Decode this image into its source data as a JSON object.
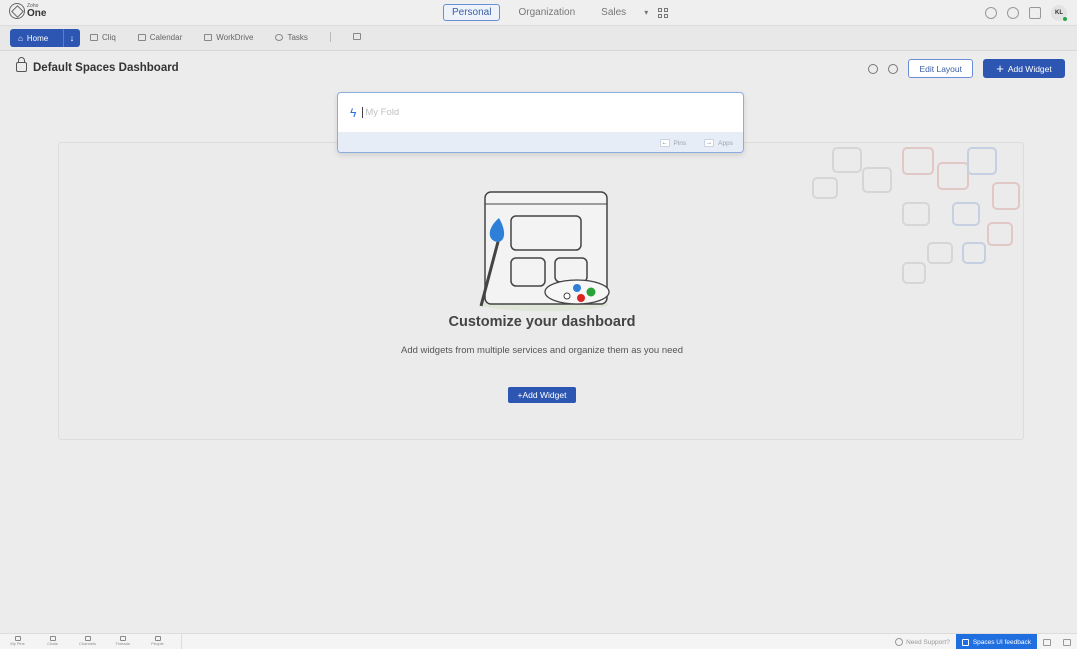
{
  "app": {
    "logo_small": "Zoho",
    "logo_big": "One"
  },
  "scope_tabs": [
    "Personal",
    "Organization",
    "Sales"
  ],
  "user": {
    "initials": "KL"
  },
  "nav": {
    "home": "Home",
    "items": [
      "Cliq",
      "Calendar",
      "WorkDrive",
      "Tasks"
    ]
  },
  "header": {
    "title": "Default Spaces Dashboard",
    "edit_layout": "Edit Layout",
    "add_widget": "Add Widget"
  },
  "search": {
    "placeholder": "My Fold",
    "hint_left": "Pins",
    "hint_right": "Apps"
  },
  "empty_state": {
    "title": "Customize your dashboard",
    "subtitle": "Add widgets from multiple services and organize them as you need",
    "cta": "+Add Widget"
  },
  "bottom": {
    "items": [
      "My Pins",
      "Chats",
      "Channels",
      "Threads",
      "People"
    ],
    "support": "Need Support?",
    "feedback": "Spaces UI feedback"
  },
  "colors": {
    "accent": "#2d56b3",
    "feedback": "#1f6fe0",
    "online": "#28a745"
  }
}
